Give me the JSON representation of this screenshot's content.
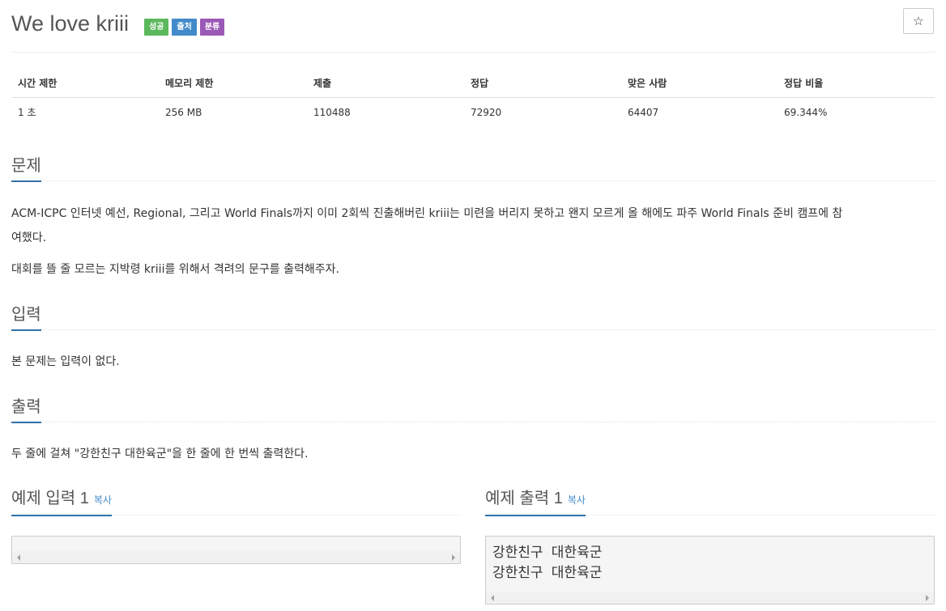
{
  "problem": {
    "title": "We love kriii",
    "labels": {
      "success": "성공",
      "source": "출처",
      "tags": "분류"
    },
    "star_icon": "☆"
  },
  "info_table": {
    "headers": [
      "시간 제한",
      "메모리 제한",
      "제출",
      "정답",
      "맞은 사람",
      "정답 비율"
    ],
    "values": [
      "1 초",
      "256 MB",
      "110488",
      "72920",
      "64407",
      "69.344%"
    ]
  },
  "sections": {
    "description": {
      "heading": "문제",
      "paragraph1_line1": "ACM-ICPC 인터넷 예선, Regional, 그리고 World Finals까지 이미 2회씩 진출해버린 kriii는 미련을 버리지 못하고 왠지 모르게 올 해에도 파주 World Finals 준비 캠프에 참",
      "paragraph1_line2": "여했다.",
      "paragraph2": "대회를 뜰 줄 모르는 지박령 kriii를 위해서 격려의 문구를 출력해주자."
    },
    "input": {
      "heading": "입력",
      "paragraph": "본 문제는 입력이 없다."
    },
    "output": {
      "heading": "출력",
      "paragraph": "두 줄에 걸쳐 \"강한친구 대한육군\"을 한 줄에 한 번씩 출력한다."
    }
  },
  "samples": {
    "input": {
      "heading": "예제 입력 1",
      "copy_label": "복사",
      "content": ""
    },
    "output": {
      "heading": "예제 출력 1",
      "copy_label": "복사",
      "line1": "강한친구 대한육군",
      "line2": "강한친구 대한육군"
    }
  },
  "colors": {
    "label_success": "#5cb85c",
    "label_source": "#428bca",
    "label_tags": "#9b59b6",
    "headline_underline": "#3071a9",
    "link": "#428bca"
  }
}
